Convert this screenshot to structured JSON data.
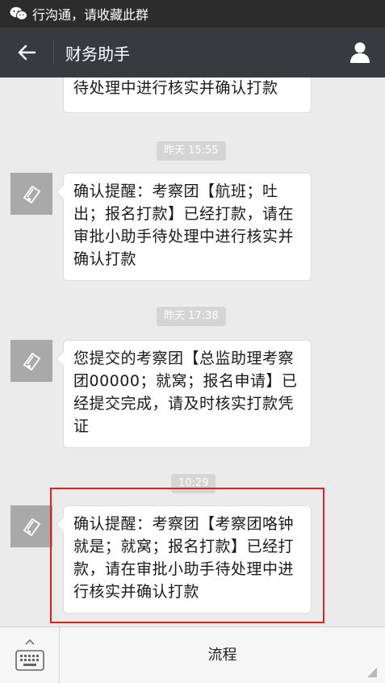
{
  "status_bar": {
    "text": "行沟通，请收藏此群"
  },
  "titlebar": {
    "title": "财务助手"
  },
  "messages": [
    {
      "text_line1": "待处理中进行核实并确认打款"
    },
    {
      "time": "昨天 15:55",
      "text": "确认提醒：考察团【航班；吐出；报名打款】已经打款，请在审批小助手待处理中进行核实并确认打款"
    },
    {
      "time": "昨天 17:38",
      "text": "您提交的考察团【总监助理考察团00000；就窝；报名申请】已经提交完成，请及时核实打款凭证"
    },
    {
      "time": "10:29",
      "text": "确认提醒：考察团【考察团咯钟就是；就窝；报名打款】已经打款，请在审批小助手待处理中进行核实并确认打款"
    }
  ],
  "bottombar": {
    "menu_label": "流程"
  },
  "icons": {
    "wechat": "wechat-icon",
    "back": "back-arrow-icon",
    "profile": "person-icon",
    "avatar": "ticket-icon",
    "keyboard": "keyboard-icon"
  },
  "colors": {
    "highlight": "#e02020",
    "titlebar": "#393a3f"
  }
}
